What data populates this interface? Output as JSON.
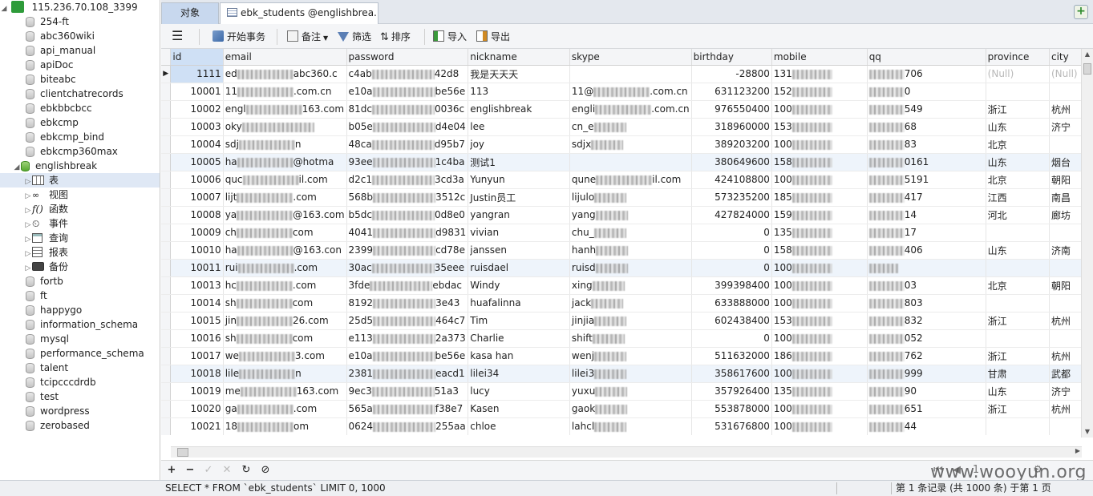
{
  "sidebar": {
    "connection": "115.236.70.108_3399",
    "databases_before": [
      "254-ft",
      "abc360wiki",
      "api_manual",
      "apiDoc",
      "biteabc",
      "clientchatrecords",
      "ebkbbcbcc",
      "ebkcmp",
      "ebkcmp_bind",
      "ebkcmp360max"
    ],
    "open_db": "englishbreak",
    "open_db_children": [
      {
        "label": "表",
        "icon": "table-icon"
      },
      {
        "label": "视图",
        "icon": "view-icon"
      },
      {
        "label": "函数",
        "icon": "function-icon"
      },
      {
        "label": "事件",
        "icon": "event-icon"
      },
      {
        "label": "查询",
        "icon": "query-icon"
      },
      {
        "label": "报表",
        "icon": "report-icon"
      },
      {
        "label": "备份",
        "icon": "backup-icon"
      }
    ],
    "databases_after": [
      "fortb",
      "ft",
      "happygo",
      "information_schema",
      "mysql",
      "performance_schema",
      "talent",
      "tcipcccdrdb",
      "test",
      "wordpress",
      "zerobased"
    ]
  },
  "tabs": {
    "objects": "对象",
    "table": "ebk_students @englishbrea..."
  },
  "toolbar": {
    "begin_tx": "开始事务",
    "note": "备注",
    "filter": "筛选",
    "sort": "排序",
    "import": "导入",
    "export": "导出"
  },
  "columns": [
    "id",
    "email",
    "password",
    "nickname",
    "skype",
    "birthday",
    "mobile",
    "qq",
    "province",
    "city"
  ],
  "rows": [
    {
      "id": "1111",
      "email": "ed",
      "email_tail": "abc360.c",
      "password": "c4ab",
      "password_tail": "42d8",
      "nickname": "我是天天天",
      "skype": "",
      "birthday": "-28800",
      "mobile": "131",
      "qq_tail": "706",
      "province": "(Null)",
      "city": "(Null)"
    },
    {
      "id": "10001",
      "email": "11",
      "email_tail": ".com.cn",
      "password": "e10a",
      "password_tail": "be56e",
      "nickname": "113",
      "skype": "11@",
      "skype_tail": ".com.cn",
      "birthday": "631123200",
      "mobile": "152",
      "qq_tail": "0",
      "province": "",
      "city": ""
    },
    {
      "id": "10002",
      "email": "engl",
      "email_tail": "163.com",
      "password": "81dc",
      "password_tail": "0036c",
      "nickname": "englishbreak",
      "skype": "engli",
      "skype_tail": ".com.cn",
      "birthday": "976550400",
      "mobile": "100",
      "qq_tail": "549",
      "province": "浙江",
      "city": "杭州"
    },
    {
      "id": "10003",
      "email": "oky",
      "email_tail": "",
      "password": "b05e",
      "password_tail": "d4e04",
      "nickname": "lee",
      "skype": "cn_e",
      "skype_tail": "",
      "birthday": "318960000",
      "mobile": "153",
      "qq_tail": "68",
      "province": "山东",
      "city": "济宁"
    },
    {
      "id": "10004",
      "email": "sdj",
      "email_tail": "n",
      "password": "48ca",
      "password_tail": "d95b7",
      "nickname": "joy",
      "skype": "sdjx",
      "skype_tail": "",
      "birthday": "389203200",
      "mobile": "100",
      "qq_tail": "83",
      "province": "北京",
      "city": ""
    },
    {
      "id": "10005",
      "email": "ha",
      "email_tail": "@hotma",
      "password": "93ee",
      "password_tail": "1c4ba",
      "nickname": "测试1",
      "skype": "",
      "birthday": "380649600",
      "mobile": "158",
      "qq_tail": "0161",
      "province": "山东",
      "city": "烟台"
    },
    {
      "id": "10006",
      "email": "quc",
      "email_tail": "il.com",
      "password": "d2c1",
      "password_tail": "3cd3a",
      "nickname": "Yunyun",
      "skype": "qune",
      "skype_tail": "il.com",
      "birthday": "424108800",
      "mobile": "100",
      "qq_tail": "5191",
      "province": "北京",
      "city": "朝阳"
    },
    {
      "id": "10007",
      "email": "lijt",
      "email_tail": ".com",
      "password": "568b",
      "password_tail": "3512c",
      "nickname": "Justin员工",
      "skype": "lijulo",
      "skype_tail": "",
      "birthday": "573235200",
      "mobile": "185",
      "qq_tail": "417",
      "province": "江西",
      "city": "南昌"
    },
    {
      "id": "10008",
      "email": "ya",
      "email_tail": "@163.com",
      "password": "b5dc",
      "password_tail": "0d8e0",
      "nickname": "yangran",
      "skype": "yang",
      "skype_tail": "",
      "birthday": "427824000",
      "mobile": "159",
      "qq_tail": "14",
      "province": "河北",
      "city": "廊坊"
    },
    {
      "id": "10009",
      "email": "ch",
      "email_tail": "com",
      "password": "4041",
      "password_tail": "d9831",
      "nickname": "vivian",
      "skype": "chu_",
      "skype_tail": "",
      "birthday": "0",
      "mobile": "135",
      "qq_tail": "17",
      "province": "",
      "city": ""
    },
    {
      "id": "10010",
      "email": "ha",
      "email_tail": "@163.con",
      "password": "2399",
      "password_tail": "cd78e",
      "nickname": "janssen",
      "skype": "hanh",
      "skype_tail": "",
      "birthday": "0",
      "mobile": "158",
      "qq_tail": "406",
      "province": "山东",
      "city": "济南"
    },
    {
      "id": "10011",
      "email": "rui",
      "email_tail": ".com",
      "password": "30ac",
      "password_tail": "35eee",
      "nickname": "ruisdael",
      "skype": "ruisd",
      "skype_tail": "",
      "birthday": "0",
      "mobile": "100",
      "qq_tail": "",
      "province": "",
      "city": ""
    },
    {
      "id": "10013",
      "email": "hc",
      "email_tail": ".com",
      "password": "3fde",
      "password_tail": "ebdac",
      "nickname": "Windy",
      "skype": "xing",
      "skype_tail": "",
      "birthday": "399398400",
      "mobile": "100",
      "qq_tail": "03",
      "province": "北京",
      "city": "朝阳"
    },
    {
      "id": "10014",
      "email": "sh",
      "email_tail": "com",
      "password": "8192",
      "password_tail": "3e43",
      "nickname": "huafalinna",
      "skype": "jack",
      "skype_tail": "",
      "birthday": "633888000",
      "mobile": "100",
      "qq_tail": "803",
      "province": "",
      "city": ""
    },
    {
      "id": "10015",
      "email": "jin",
      "email_tail": "26.com",
      "password": "25d5",
      "password_tail": "464c7",
      "nickname": "Tim",
      "skype": "jinjia",
      "skype_tail": "",
      "birthday": "602438400",
      "mobile": "153",
      "qq_tail": "832",
      "province": "浙江",
      "city": "杭州"
    },
    {
      "id": "10016",
      "email": "sh",
      "email_tail": "com",
      "password": "e113",
      "password_tail": "2a373",
      "nickname": "Charlie",
      "skype": "shift",
      "skype_tail": "",
      "birthday": "0",
      "mobile": "100",
      "qq_tail": "052",
      "province": "",
      "city": ""
    },
    {
      "id": "10017",
      "email": "we",
      "email_tail": "3.com",
      "password": "e10a",
      "password_tail": "be56e",
      "nickname": "kasa han",
      "skype": "wenj",
      "skype_tail": "",
      "birthday": "511632000",
      "mobile": "186",
      "qq_tail": "762",
      "province": "浙江",
      "city": "杭州"
    },
    {
      "id": "10018",
      "email": "lile",
      "email_tail": "n",
      "password": "2381",
      "password_tail": "eacd1",
      "nickname": "lilei34",
      "skype": "lilei3",
      "skype_tail": "",
      "birthday": "358617600",
      "mobile": "100",
      "qq_tail": "999",
      "province": "甘肃",
      "city": "武都"
    },
    {
      "id": "10019",
      "email": "me",
      "email_tail": "163.com",
      "password": "9ec3",
      "password_tail": "51a3",
      "nickname": "lucy",
      "skype": "yuxu",
      "skype_tail": "",
      "birthday": "357926400",
      "mobile": "135",
      "qq_tail": "90",
      "province": "山东",
      "city": "济宁"
    },
    {
      "id": "10020",
      "email": "ga",
      "email_tail": ".com",
      "password": "565a",
      "password_tail": "f38e7",
      "nickname": "Kasen",
      "skype": "gaok",
      "skype_tail": "",
      "birthday": "553878000",
      "mobile": "100",
      "qq_tail": "651",
      "province": "浙江",
      "city": "杭州"
    },
    {
      "id": "10021",
      "email": "18",
      "email_tail": "om",
      "password": "0624",
      "password_tail": "255aa",
      "nickname": "chloe",
      "skype": "lahcl",
      "skype_tail": "",
      "birthday": "531676800",
      "mobile": "100",
      "qq_tail": "44",
      "province": "",
      "city": ""
    }
  ],
  "statusbar": {
    "sql": "SELECT * FROM `ebk_students` LIMIT 0, 1000",
    "record_info": "第 1 条记录 (共 1000 条) 于第 1 页"
  },
  "navbar": {
    "page": "1"
  },
  "watermark": "www.wooyun.org"
}
